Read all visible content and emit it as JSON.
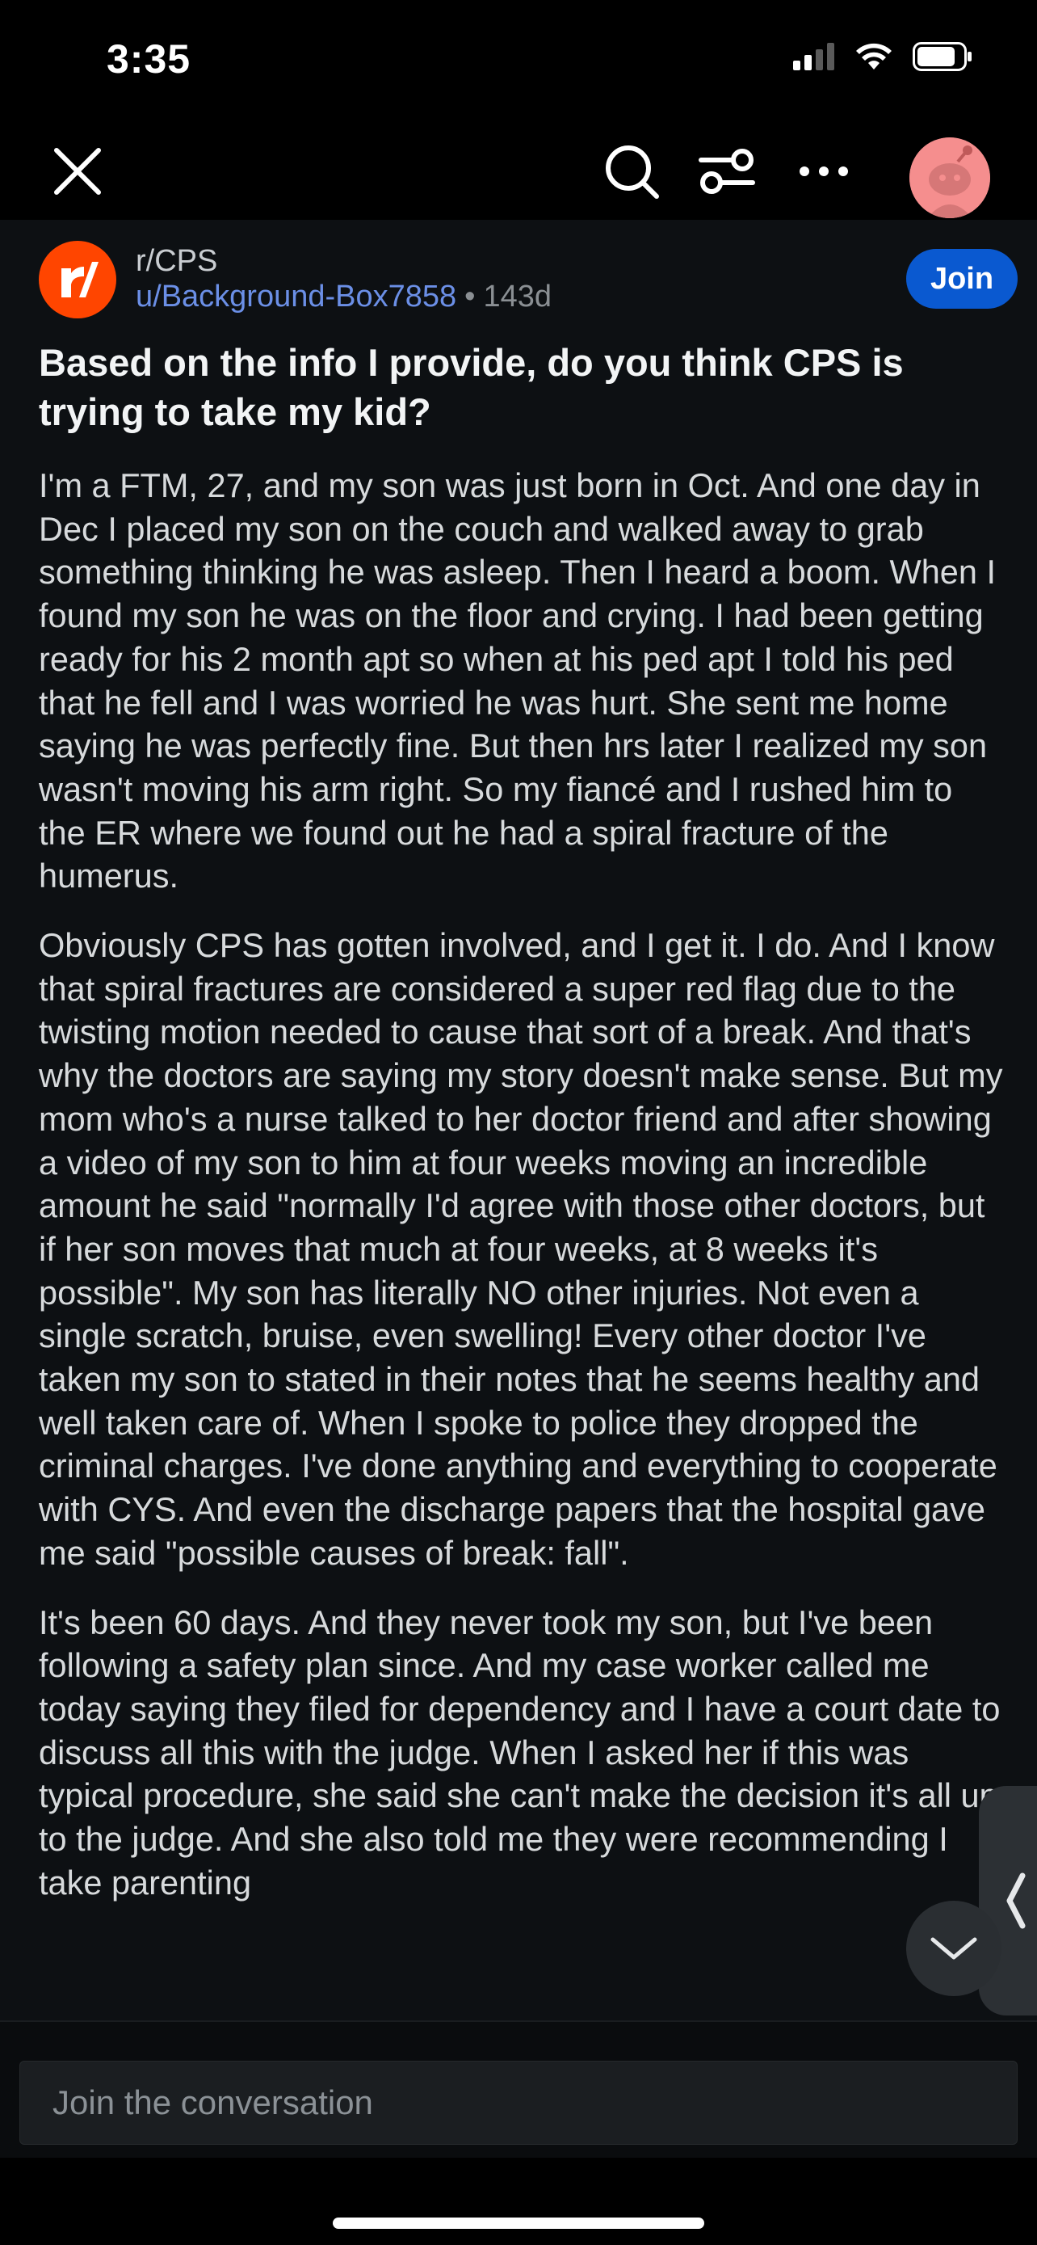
{
  "status_bar": {
    "time": "3:35"
  },
  "top_bar": {
    "close_icon": "close-icon",
    "search_icon": "search-icon",
    "filter_icon": "sliders-icon",
    "more_icon": "more-horizontal-icon",
    "avatar_icon": "user-avatar-icon"
  },
  "post": {
    "subreddit": "r/CPS",
    "author": "u/Background-Box7858",
    "separator": "•",
    "age": "143d",
    "join_label": "Join",
    "title": "Based on the info I provide, do you think CPS is trying to take my kid?",
    "body": [
      "I'm a FTM, 27, and my son was just born in Oct. And one day in Dec I placed my son on the couch and walked away to grab something thinking he was asleep. Then I heard a boom. When I found my son he was on the floor and crying. I had been getting ready for his 2 month apt so when at his ped apt I told his ped that he fell and I was worried he was hurt. She sent me home saying he was perfectly fine. But then hrs later I realized my son wasn't moving his arm right. So my fiancé and I rushed him to the ER where we found out he had a spiral fracture of the humerus.",
      "Obviously CPS has gotten involved, and I get it. I do. And I know that spiral fractures are considered a super red flag due to the twisting motion needed to cause that sort of a break. And that's why the doctors are saying my story doesn't make sense. But my mom who's a nurse talked to her doctor friend and after showing a video of my son to him at four weeks moving an incredible amount he said \"normally I'd agree with those other doctors, but if her son moves that much at four weeks, at 8 weeks it's possible\". My son has literally NO other injuries. Not even a single scratch, bruise, even swelling! Every other doctor I've taken my son to stated in their notes that he seems healthy and well taken care of. When I spoke to police they dropped the criminal charges. I've done anything and everything to cooperate with CYS. And even the discharge papers that the hospital gave me said \"possible causes of break: fall\".",
      "It's been 60 days. And they never took my son, but I've been following a safety plan since. And my case worker called me today saying they filed for dependency and I have a court date to discuss all this with the judge. When I asked her if this was typical procedure, she said she can't make the decision it's all up to the judge. And she also told me they were recommending I take parenting"
    ]
  },
  "reply": {
    "placeholder": "Join the conversation"
  },
  "colors": {
    "join": "#0a59d0",
    "subreddit_icon": "#ff4500",
    "author_link": "#6b8fe6"
  }
}
